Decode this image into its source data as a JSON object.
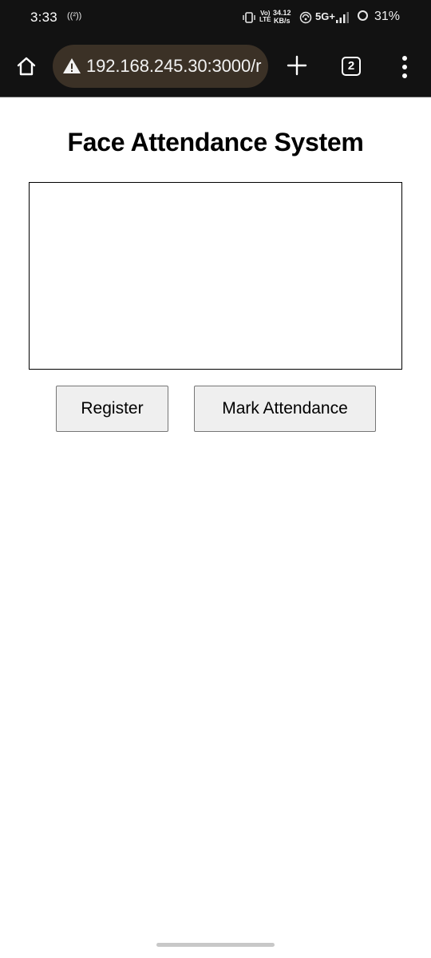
{
  "status_bar": {
    "time": "3:33",
    "hotspot_label": "((²))",
    "volte_line1": "Vo)",
    "volte_line2": "LTE",
    "speed_value": "34.12",
    "speed_unit": "KB/s",
    "network_type": "5G+",
    "battery_percent": "31%",
    "icons": [
      "vibrate-icon",
      "wifi-icon",
      "signal-icon",
      "battery-icon"
    ]
  },
  "browser": {
    "url": "192.168.245.30:3000/r",
    "tab_count": "2",
    "icons": [
      "home-icon",
      "warning-icon",
      "plus-icon",
      "tabs-icon",
      "more-vert-icon"
    ],
    "toolbar_bg": "#121212",
    "url_pill_bg": "#3b3126"
  },
  "page": {
    "title": "Face Attendance System",
    "register_label": "Register",
    "mark_attendance_label": "Mark Attendance"
  }
}
